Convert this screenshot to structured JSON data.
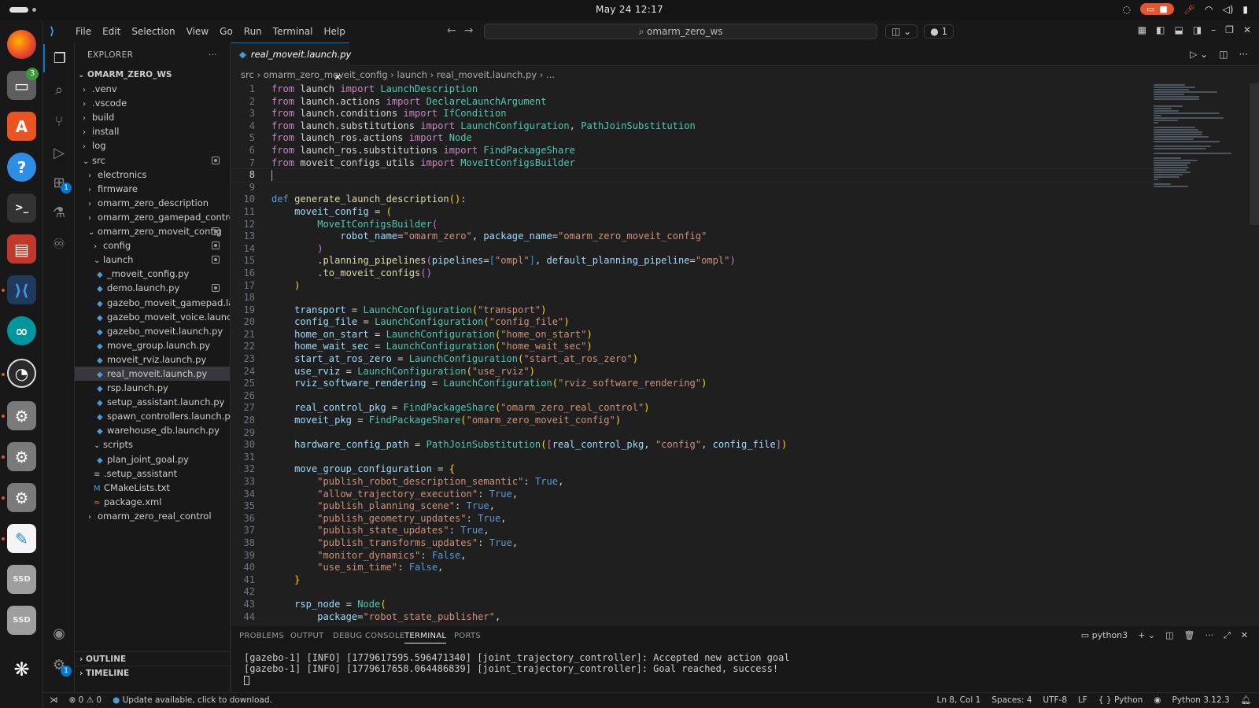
{
  "system": {
    "clock": "May 24  12:17"
  },
  "window": {
    "menu": [
      "File",
      "Edit",
      "Selection",
      "View",
      "Go",
      "Run",
      "Terminal",
      "Help"
    ],
    "search_label": "omarm_zero_ws",
    "ports_badge": "1"
  },
  "dock": {
    "files_badge": "3",
    "extensions_badge": "1",
    "ssd1": "SSD",
    "ssd2": "SSD"
  },
  "activity": {
    "extensions_badge": "1",
    "settings_badge": "1"
  },
  "explorer": {
    "title": "EXPLORER",
    "more": "···",
    "root": "OMARM_ZERO_WS",
    "tree": [
      {
        "label": ".venv",
        "depth": 0,
        "type": "folder"
      },
      {
        "label": ".vscode",
        "depth": 0,
        "type": "folder"
      },
      {
        "label": "build",
        "depth": 0,
        "type": "folder"
      },
      {
        "label": "install",
        "depth": 0,
        "type": "folder"
      },
      {
        "label": "log",
        "depth": 0,
        "type": "folder"
      },
      {
        "label": "src",
        "depth": 0,
        "type": "folder-open",
        "mod": true
      },
      {
        "label": "electronics",
        "depth": 1,
        "type": "folder"
      },
      {
        "label": "firmware",
        "depth": 1,
        "type": "folder"
      },
      {
        "label": "omarm_zero_description",
        "depth": 1,
        "type": "folder"
      },
      {
        "label": "omarm_zero_gamepad_control",
        "depth": 1,
        "type": "folder"
      },
      {
        "label": "omarm_zero_moveit_config",
        "depth": 1,
        "type": "folder-open",
        "mod": true
      },
      {
        "label": "config",
        "depth": 2,
        "type": "folder",
        "mod": true
      },
      {
        "label": "launch",
        "depth": 2,
        "type": "folder-open",
        "mod": true
      },
      {
        "label": "_moveit_config.py",
        "depth": 3,
        "type": "py"
      },
      {
        "label": "demo.launch.py",
        "depth": 3,
        "type": "py",
        "mod": true
      },
      {
        "label": "gazebo_moveit_gamepad.la...",
        "depth": 3,
        "type": "py"
      },
      {
        "label": "gazebo_moveit_voice.launch...",
        "depth": 3,
        "type": "py"
      },
      {
        "label": "gazebo_moveit.launch.py",
        "depth": 3,
        "type": "py"
      },
      {
        "label": "move_group.launch.py",
        "depth": 3,
        "type": "py"
      },
      {
        "label": "moveit_rviz.launch.py",
        "depth": 3,
        "type": "py"
      },
      {
        "label": "real_moveit.launch.py",
        "depth": 3,
        "type": "py",
        "selected": true
      },
      {
        "label": "rsp.launch.py",
        "depth": 3,
        "type": "py"
      },
      {
        "label": "setup_assistant.launch.py",
        "depth": 3,
        "type": "py"
      },
      {
        "label": "spawn_controllers.launch.py",
        "depth": 3,
        "type": "py"
      },
      {
        "label": "warehouse_db.launch.py",
        "depth": 3,
        "type": "py"
      },
      {
        "label": "scripts",
        "depth": 2,
        "type": "folder-open"
      },
      {
        "label": "plan_joint_goal.py",
        "depth": 3,
        "type": "py"
      },
      {
        "label": ".setup_assistant",
        "depth": 2,
        "type": "txt"
      },
      {
        "label": "CMakeLists.txt",
        "depth": 2,
        "type": "cmake"
      },
      {
        "label": "package.xml",
        "depth": 2,
        "type": "xml"
      },
      {
        "label": "omarm_zero_real_control",
        "depth": 1,
        "type": "folder"
      }
    ],
    "outline": "OUTLINE",
    "timeline": "TIMELINE"
  },
  "editor": {
    "tab": "real_moveit.launch.py",
    "breadcrumb": [
      "src",
      "omarm_zero_moveit_config",
      "launch",
      "real_moveit.launch.py",
      "..."
    ],
    "lines": [
      [
        [
          "kw",
          "from"
        ],
        [
          "pl",
          " launch "
        ],
        [
          "kw",
          "import"
        ],
        [
          "cls",
          " LaunchDescription"
        ]
      ],
      [
        [
          "kw",
          "from"
        ],
        [
          "pl",
          " launch.actions "
        ],
        [
          "kw",
          "import"
        ],
        [
          "cls",
          " DeclareLaunchArgument"
        ]
      ],
      [
        [
          "kw",
          "from"
        ],
        [
          "pl",
          " launch.conditions "
        ],
        [
          "kw",
          "import"
        ],
        [
          "cls",
          " IfCondition"
        ]
      ],
      [
        [
          "kw",
          "from"
        ],
        [
          "pl",
          " launch.substitutions "
        ],
        [
          "kw",
          "import"
        ],
        [
          "cls",
          " LaunchConfiguration"
        ],
        [
          "pl",
          ", "
        ],
        [
          "cls",
          "PathJoinSubstitution"
        ]
      ],
      [
        [
          "kw",
          "from"
        ],
        [
          "pl",
          " launch_ros.actions "
        ],
        [
          "kw",
          "import"
        ],
        [
          "cls",
          " Node"
        ]
      ],
      [
        [
          "kw",
          "from"
        ],
        [
          "pl",
          " launch_ros.substitutions "
        ],
        [
          "kw",
          "import"
        ],
        [
          "cls",
          " FindPackageShare"
        ]
      ],
      [
        [
          "kw",
          "from"
        ],
        [
          "pl",
          " moveit_configs_utils "
        ],
        [
          "kw",
          "import"
        ],
        [
          "cls",
          " MoveItConfigsBuilder"
        ]
      ],
      [],
      [],
      [
        [
          "def",
          "def"
        ],
        [
          "fn",
          " generate_launch_description"
        ],
        [
          "br1",
          "()"
        ],
        [
          "pl",
          ":"
        ]
      ],
      [
        [
          "pl",
          "    "
        ],
        [
          "var",
          "moveit_config"
        ],
        [
          "pl",
          " = "
        ],
        [
          "br1",
          "("
        ]
      ],
      [
        [
          "pl",
          "        "
        ],
        [
          "cls",
          "MoveItConfigsBuilder"
        ],
        [
          "br2",
          "("
        ]
      ],
      [
        [
          "pl",
          "            "
        ],
        [
          "var",
          "robot_name"
        ],
        [
          "pl",
          "="
        ],
        [
          "str",
          "\"omarm_zero\""
        ],
        [
          "pl",
          ", "
        ],
        [
          "var",
          "package_name"
        ],
        [
          "pl",
          "="
        ],
        [
          "str",
          "\"omarm_zero_moveit_config\""
        ]
      ],
      [
        [
          "pl",
          "        "
        ],
        [
          "br2",
          ")"
        ]
      ],
      [
        [
          "pl",
          "        ."
        ],
        [
          "fn",
          "planning_pipelines"
        ],
        [
          "br2",
          "("
        ],
        [
          "var",
          "pipelines"
        ],
        [
          "pl",
          "="
        ],
        [
          "br3",
          "["
        ],
        [
          "str",
          "\"ompl\""
        ],
        [
          "br3",
          "]"
        ],
        [
          "pl",
          ", "
        ],
        [
          "var",
          "default_planning_pipeline"
        ],
        [
          "pl",
          "="
        ],
        [
          "str",
          "\"ompl\""
        ],
        [
          "br2",
          ")"
        ]
      ],
      [
        [
          "pl",
          "        ."
        ],
        [
          "fn",
          "to_moveit_configs"
        ],
        [
          "br2",
          "()"
        ]
      ],
      [
        [
          "pl",
          "    "
        ],
        [
          "br1",
          ")"
        ]
      ],
      [],
      [
        [
          "pl",
          "    "
        ],
        [
          "var",
          "transport"
        ],
        [
          "pl",
          " = "
        ],
        [
          "cls",
          "LaunchConfiguration"
        ],
        [
          "br1",
          "("
        ],
        [
          "str",
          "\"transport\""
        ],
        [
          "br1",
          ")"
        ]
      ],
      [
        [
          "pl",
          "    "
        ],
        [
          "var",
          "config_file"
        ],
        [
          "pl",
          " = "
        ],
        [
          "cls",
          "LaunchConfiguration"
        ],
        [
          "br1",
          "("
        ],
        [
          "str",
          "\"config_file\""
        ],
        [
          "br1",
          ")"
        ]
      ],
      [
        [
          "pl",
          "    "
        ],
        [
          "var",
          "home_on_start"
        ],
        [
          "pl",
          " = "
        ],
        [
          "cls",
          "LaunchConfiguration"
        ],
        [
          "br1",
          "("
        ],
        [
          "str",
          "\"home_on_start\""
        ],
        [
          "br1",
          ")"
        ]
      ],
      [
        [
          "pl",
          "    "
        ],
        [
          "var",
          "home_wait_sec"
        ],
        [
          "pl",
          " = "
        ],
        [
          "cls",
          "LaunchConfiguration"
        ],
        [
          "br1",
          "("
        ],
        [
          "str",
          "\"home_wait_sec\""
        ],
        [
          "br1",
          ")"
        ]
      ],
      [
        [
          "pl",
          "    "
        ],
        [
          "var",
          "start_at_ros_zero"
        ],
        [
          "pl",
          " = "
        ],
        [
          "cls",
          "LaunchConfiguration"
        ],
        [
          "br1",
          "("
        ],
        [
          "str",
          "\"start_at_ros_zero\""
        ],
        [
          "br1",
          ")"
        ]
      ],
      [
        [
          "pl",
          "    "
        ],
        [
          "var",
          "use_rviz"
        ],
        [
          "pl",
          " = "
        ],
        [
          "cls",
          "LaunchConfiguration"
        ],
        [
          "br1",
          "("
        ],
        [
          "str",
          "\"use_rviz\""
        ],
        [
          "br1",
          ")"
        ]
      ],
      [
        [
          "pl",
          "    "
        ],
        [
          "var",
          "rviz_software_rendering"
        ],
        [
          "pl",
          " = "
        ],
        [
          "cls",
          "LaunchConfiguration"
        ],
        [
          "br1",
          "("
        ],
        [
          "str",
          "\"rviz_software_rendering\""
        ],
        [
          "br1",
          ")"
        ]
      ],
      [],
      [
        [
          "pl",
          "    "
        ],
        [
          "var",
          "real_control_pkg"
        ],
        [
          "pl",
          " = "
        ],
        [
          "cls",
          "FindPackageShare"
        ],
        [
          "br1",
          "("
        ],
        [
          "str",
          "\"omarm_zero_real_control\""
        ],
        [
          "br1",
          ")"
        ]
      ],
      [
        [
          "pl",
          "    "
        ],
        [
          "var",
          "moveit_pkg"
        ],
        [
          "pl",
          " = "
        ],
        [
          "cls",
          "FindPackageShare"
        ],
        [
          "br1",
          "("
        ],
        [
          "str",
          "\"omarm_zero_moveit_config\""
        ],
        [
          "br1",
          ")"
        ]
      ],
      [],
      [
        [
          "pl",
          "    "
        ],
        [
          "var",
          "hardware_config_path"
        ],
        [
          "pl",
          " = "
        ],
        [
          "cls",
          "PathJoinSubstitution"
        ],
        [
          "br1",
          "("
        ],
        [
          "br2",
          "["
        ],
        [
          "var",
          "real_control_pkg"
        ],
        [
          "pl",
          ", "
        ],
        [
          "str",
          "\"config\""
        ],
        [
          "pl",
          ", "
        ],
        [
          "var",
          "config_file"
        ],
        [
          "br2",
          "]"
        ],
        [
          "br1",
          ")"
        ]
      ],
      [],
      [
        [
          "pl",
          "    "
        ],
        [
          "var",
          "move_group_configuration"
        ],
        [
          "pl",
          " = "
        ],
        [
          "br1",
          "{"
        ]
      ],
      [
        [
          "pl",
          "        "
        ],
        [
          "str",
          "\"publish_robot_description_semantic\""
        ],
        [
          "pl",
          ": "
        ],
        [
          "cst",
          "True"
        ],
        [
          "pl",
          ","
        ]
      ],
      [
        [
          "pl",
          "        "
        ],
        [
          "str",
          "\"allow_trajectory_execution\""
        ],
        [
          "pl",
          ": "
        ],
        [
          "cst",
          "True"
        ],
        [
          "pl",
          ","
        ]
      ],
      [
        [
          "pl",
          "        "
        ],
        [
          "str",
          "\"publish_planning_scene\""
        ],
        [
          "pl",
          ": "
        ],
        [
          "cst",
          "True"
        ],
        [
          "pl",
          ","
        ]
      ],
      [
        [
          "pl",
          "        "
        ],
        [
          "str",
          "\"publish_geometry_updates\""
        ],
        [
          "pl",
          ": "
        ],
        [
          "cst",
          "True"
        ],
        [
          "pl",
          ","
        ]
      ],
      [
        [
          "pl",
          "        "
        ],
        [
          "str",
          "\"publish_state_updates\""
        ],
        [
          "pl",
          ": "
        ],
        [
          "cst",
          "True"
        ],
        [
          "pl",
          ","
        ]
      ],
      [
        [
          "pl",
          "        "
        ],
        [
          "str",
          "\"publish_transforms_updates\""
        ],
        [
          "pl",
          ": "
        ],
        [
          "cst",
          "True"
        ],
        [
          "pl",
          ","
        ]
      ],
      [
        [
          "pl",
          "        "
        ],
        [
          "str",
          "\"monitor_dynamics\""
        ],
        [
          "pl",
          ": "
        ],
        [
          "cst",
          "False"
        ],
        [
          "pl",
          ","
        ]
      ],
      [
        [
          "pl",
          "        "
        ],
        [
          "str",
          "\"use_sim_time\""
        ],
        [
          "pl",
          ": "
        ],
        [
          "cst",
          "False"
        ],
        [
          "pl",
          ","
        ]
      ],
      [
        [
          "pl",
          "    "
        ],
        [
          "br1",
          "}"
        ]
      ],
      [],
      [
        [
          "pl",
          "    "
        ],
        [
          "var",
          "rsp_node"
        ],
        [
          "pl",
          " = "
        ],
        [
          "cls",
          "Node"
        ],
        [
          "br1",
          "("
        ]
      ],
      [
        [
          "pl",
          "        "
        ],
        [
          "var",
          "package"
        ],
        [
          "pl",
          "="
        ],
        [
          "str",
          "\"robot_state_publisher\""
        ],
        [
          "pl",
          ","
        ]
      ]
    ],
    "cursor_line": 8
  },
  "panel": {
    "tabs": [
      "PROBLEMS",
      "OUTPUT",
      "DEBUG CONSOLE",
      "TERMINAL",
      "PORTS"
    ],
    "active_tab": "TERMINAL",
    "shell": "python3",
    "terminal": [
      "[gazebo-1] [INFO] [1779617595.596471340] [joint_trajectory_controller]: Accepted new action goal",
      "[gazebo-1] [INFO] [1779617658.064486839] [joint_trajectory_controller]: Goal reached, success!"
    ]
  },
  "statusbar": {
    "errors": "0",
    "warnings": "0",
    "update": "Update available, click to download.",
    "position": "Ln 8, Col 1",
    "spaces": "Spaces: 4",
    "encoding": "UTF-8",
    "eol": "LF",
    "language": "Python",
    "interpreter": "Python 3.12.3"
  }
}
